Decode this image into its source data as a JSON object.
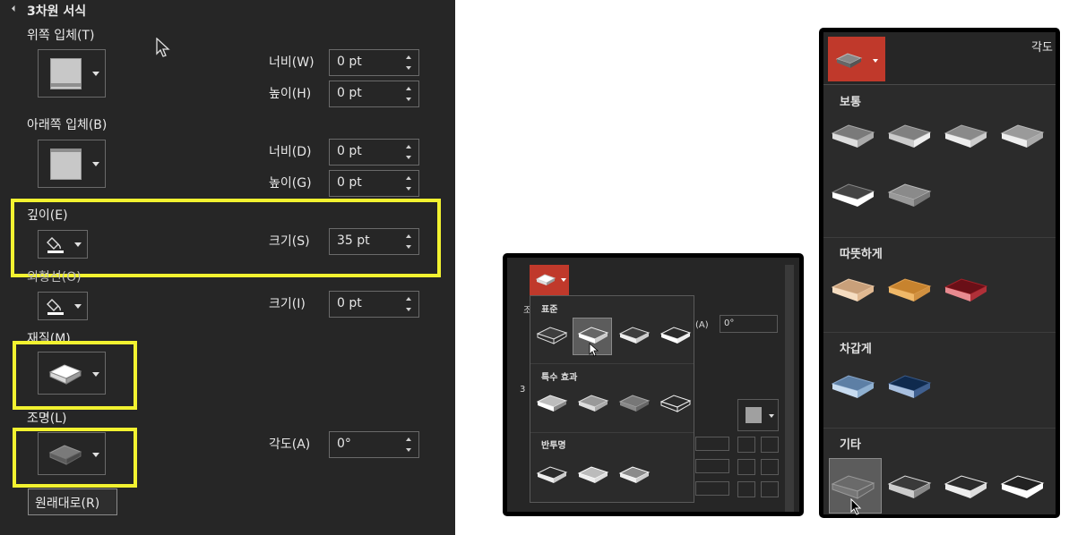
{
  "left_panel": {
    "section_title": "3차원 서식",
    "top_bevel_label": "위쪽 입체(T)",
    "bottom_bevel_label": "아래쪽 입체(B)",
    "width1_label": "너비(W)",
    "height1_label": "높이(H)",
    "width2_label": "너비(D)",
    "height2_label": "높이(G)",
    "top_width_value": "0 pt",
    "top_height_value": "0 pt",
    "bottom_width_value": "0 pt",
    "bottom_height_value": "0 pt",
    "depth_label": "깊이(E)",
    "depth_size_label": "크기(S)",
    "depth_size_value": "35 pt",
    "contour_label": "외형선(O)",
    "contour_size_label": "크기(I)",
    "contour_size_value": "0 pt",
    "material_label": "재질(M)",
    "lighting_label": "조명(L)",
    "angle_label": "각도(A)",
    "angle_value": "0°",
    "reset_button": "원래대로(R)"
  },
  "material_popup": {
    "section_standard": "표준",
    "section_special": "특수 효과",
    "section_translucent": "반투명",
    "behind_labels": {
      "jo": "조",
      "a": "(A)",
      "angle": "0°",
      "three": "3"
    }
  },
  "lighting_popup": {
    "angle_label": "각도",
    "section_normal": "보통",
    "section_warm": "따뜻하게",
    "section_cool": "차갑게",
    "section_other": "기타"
  },
  "colors": {
    "panel_bg": "#262626",
    "highlight_yellow": "#f2f230",
    "selected_red": "#c0392b"
  }
}
